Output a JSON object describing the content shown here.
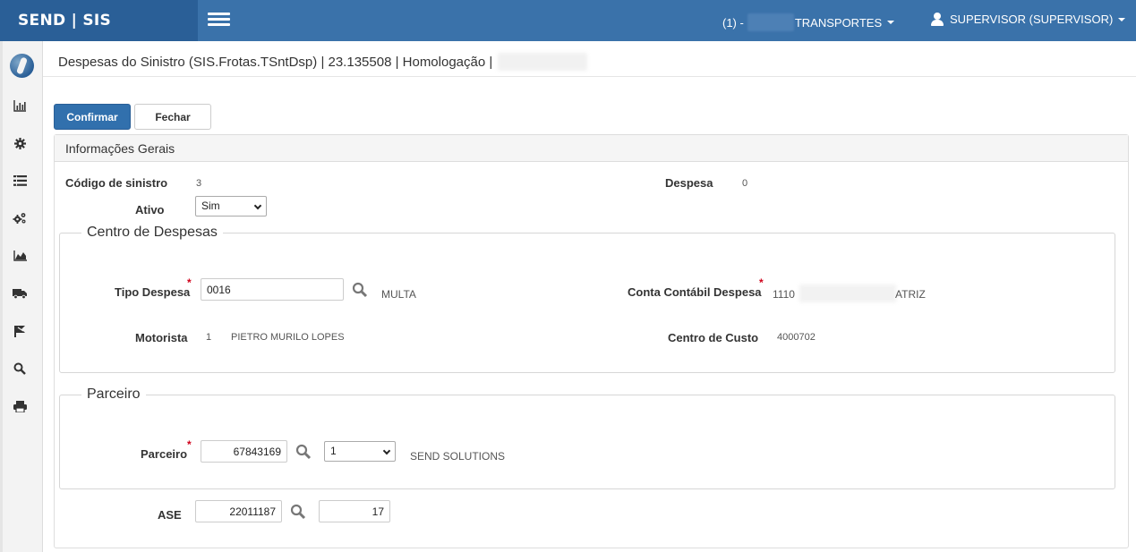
{
  "header": {
    "brand": "SEND | SIS",
    "company_prefix": "(1) -",
    "company_name": "TRANSPORTES",
    "user": "SUPERVISOR (SUPERVISOR)"
  },
  "sidebar": {
    "items": [
      {
        "icon": "bar-chart-icon",
        "glyph": "📊"
      },
      {
        "icon": "gear-icon",
        "glyph": "⚙"
      },
      {
        "icon": "list-icon",
        "glyph": "☰"
      },
      {
        "icon": "gears-icon",
        "glyph": "⚙"
      },
      {
        "icon": "area-chart-icon",
        "glyph": "▲"
      },
      {
        "icon": "truck-icon",
        "glyph": "🚚"
      },
      {
        "icon": "road-icon",
        "glyph": "⛿"
      },
      {
        "icon": "search-icon",
        "glyph": "🔍"
      },
      {
        "icon": "print-icon",
        "glyph": "🖶"
      }
    ]
  },
  "page": {
    "title": "Despesas do Sinistro (SIS.Frotas.TSntDsp) | 23.135508 | Homologação |"
  },
  "toolbar": {
    "confirm_label": "Confirmar",
    "close_label": "Fechar"
  },
  "panel": {
    "heading": "Informações Gerais",
    "codigo_label": "Código de sinistro",
    "codigo_value": "3",
    "despesa_label": "Despesa",
    "despesa_value": "0",
    "ativo_label": "Ativo",
    "ativo_selected": "Sim"
  },
  "centro": {
    "legend": "Centro de Despesas",
    "tipo_label": "Tipo Despesa",
    "tipo_value": "0016",
    "tipo_desc": "MULTA",
    "conta_label": "Conta Contábil Despesa",
    "conta_prefix": "1110",
    "conta_suffix": "ATRIZ",
    "motorista_label": "Motorista",
    "motorista_code": "1",
    "motorista_name": "PIETRO MURILO LOPES",
    "custo_label": "Centro de Custo",
    "custo_value": "4000702"
  },
  "parceiro": {
    "legend": "Parceiro",
    "label": "Parceiro",
    "value": "67843169",
    "select_value": "1",
    "desc": "SEND SOLUTIONS"
  },
  "ase": {
    "label": "ASE",
    "value": "22011187",
    "seq": "17"
  },
  "colors": {
    "topbar": "#3a72aa",
    "brand_bg": "#2a5f97",
    "primary": "#3170ad",
    "required": "#d0021b"
  }
}
